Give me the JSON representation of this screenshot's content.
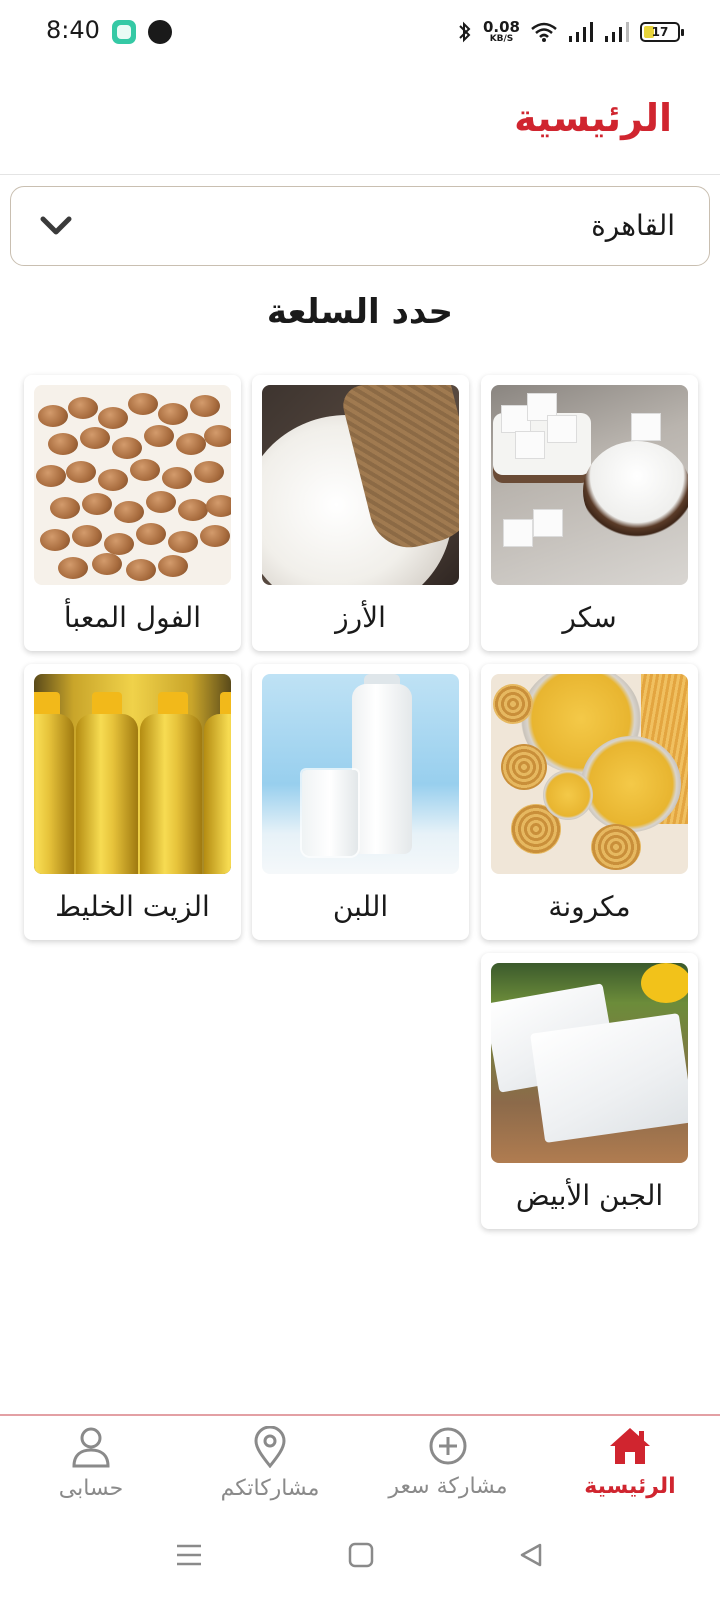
{
  "status_bar": {
    "time": "8:40",
    "net_speed_value": "0.08",
    "net_speed_unit": "KB/S",
    "battery_level": "17",
    "icons": [
      "app-icon",
      "phone-app-icon",
      "bluetooth-icon",
      "wifi-icon",
      "signal-icon",
      "signal-icon",
      "battery-icon"
    ]
  },
  "header": {
    "title": "الرئيسية"
  },
  "city_select": {
    "value": "القاهرة",
    "icon": "chevron-down-icon"
  },
  "section_title": "حدد السلعة",
  "products": [
    {
      "label": "سكر"
    },
    {
      "label": "الأرز"
    },
    {
      "label": "الفول المعبأ"
    },
    {
      "label": "مكرونة"
    },
    {
      "label": "اللبن"
    },
    {
      "label": "الزيت الخليط"
    },
    {
      "label": "الجبن الأبيض"
    }
  ],
  "bottom_nav": {
    "items": [
      {
        "label": "الرئيسية",
        "icon": "home-icon",
        "active": true
      },
      {
        "label": "مشاركة سعر",
        "icon": "plus-circle-icon",
        "active": false
      },
      {
        "label": "مشاركاتكم",
        "icon": "location-pin-icon",
        "active": false
      },
      {
        "label": "حسابى",
        "icon": "user-icon",
        "active": false
      }
    ]
  },
  "colors": {
    "accent": "#d0252f",
    "inactive": "#8a8a8a",
    "select_border": "#c9bfb1"
  }
}
